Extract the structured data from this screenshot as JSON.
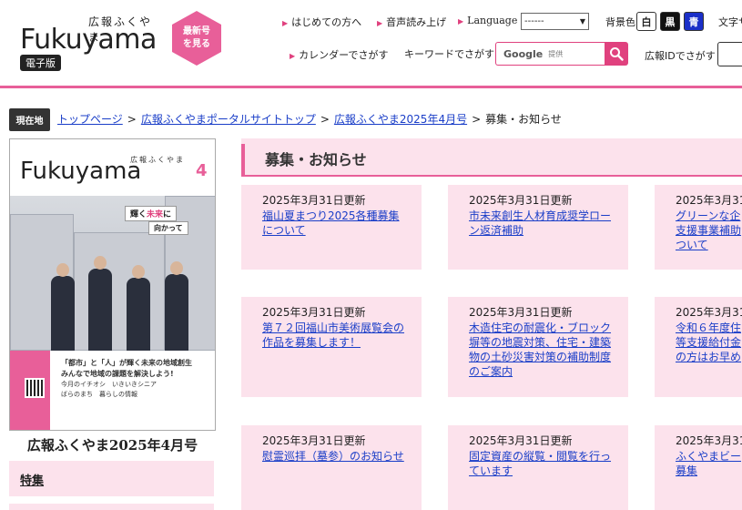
{
  "header": {
    "logo_small": "広報ふくやま",
    "logo_main": "Fukuyama",
    "logo_badge": "電子版",
    "latest_line1": "最新号",
    "latest_line2": "を見る",
    "link_first_time": "はじめての方へ",
    "link_read_aloud": "音声読み上げ",
    "link_language": "Language",
    "language_value": "------",
    "bg_label": "背景色",
    "bg_white": "白",
    "bg_black": "黒",
    "bg_blue": "青",
    "fontsize_label": "文字サイ",
    "link_calendar": "カレンダーでさがす",
    "keyword_label": "キーワードでさがす",
    "search_brand": "Google",
    "search_provided": "提供",
    "id_label": "広報IDでさがす"
  },
  "breadcrumb": {
    "tag": "現在地",
    "items": [
      "トップページ",
      "広報ふくやまポータルサイトトップ",
      "広報ふくやま2025年4月号"
    ],
    "current": "募集・お知らせ"
  },
  "sidebar": {
    "cover_small": "広報ふくやま",
    "cover_logo": "Fukuyama",
    "cover_number": "4",
    "cover_banner1_a": "輝く",
    "cover_banner1_hl": "未来",
    "cover_banner1_b": "に",
    "cover_banner2": "向かって",
    "cover_line1": "「都市」と「人」が輝く未来の地域創生",
    "cover_line2": "みんなで地域の課題を解決しよう!",
    "cover_line3": "今月のイチオシ　いきいきシニア",
    "cover_line4": "ばらのまち　暮らしの情報",
    "caption": "広報ふくやま2025年4月号",
    "item_feature": "特集"
  },
  "main": {
    "heading": "募集・お知らせ",
    "cards": [
      {
        "date": "2025年3月31日更新",
        "title": "福山夏まつり2025各種募集\nについて"
      },
      {
        "date": "2025年3月31日更新",
        "title": "市未来創生人材育成奨学ロー\nン返済補助"
      },
      {
        "date": "2025年3月31",
        "title": "グリーンな企\n支援事業補助\nついて"
      },
      {
        "date": "2025年3月31日更新",
        "title": "第７２回福山市美術展覧会の\n作品を募集します！"
      },
      {
        "date": "2025年3月31日更新",
        "title": "木造住宅の耐震化・ブロック\n塀等の地震対策、住宅・建築\n物の土砂災害対策の補助制度\nのご案内"
      },
      {
        "date": "2025年3月31",
        "title": "令和６年度住\n等支援給付金\nの方はお早め"
      },
      {
        "date": "2025年3月31日更新",
        "title": "慰霊巡拝（墓参）のお知らせ"
      },
      {
        "date": "2025年3月31日更新",
        "title": "固定資産の縦覧・閲覧を行っ\nています"
      },
      {
        "date": "2025年3月31",
        "title": "ふくやまビー\n募集"
      }
    ]
  }
}
